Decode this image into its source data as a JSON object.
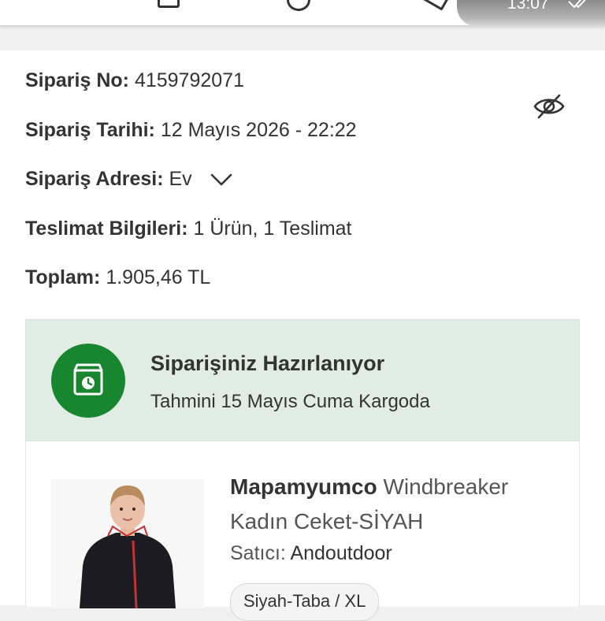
{
  "status_bar": {
    "time": "13:07"
  },
  "order": {
    "number_label": "Sipariş No:",
    "number_value": "4159792071",
    "date_label": "Sipariş Tarihi:",
    "date_value": "12 Mayıs 2026 - 22:22",
    "address_label": "Sipariş Adresi:",
    "address_value": "Ev",
    "delivery_label": "Teslimat Bilgileri:",
    "delivery_value": "1 Ürün, 1 Teslimat",
    "total_label": "Toplam:",
    "total_value": "1.905,46 TL",
    "hide_icon": "eye-off-icon"
  },
  "status": {
    "title": "Siparişiniz Hazırlanıyor",
    "subtitle": "Tahmini 15 Mayıs Cuma Kargoda",
    "icon": "package-clock-icon",
    "color": "#18852f",
    "background": "#e0ece4"
  },
  "product": {
    "brand": "Mapamyumco",
    "name": "Windbreaker Kadın Ceket-SİYAH",
    "seller_label": "Satıcı:",
    "seller_value": "Andoutdoor",
    "variant": "Siyah-Taba / XL"
  }
}
